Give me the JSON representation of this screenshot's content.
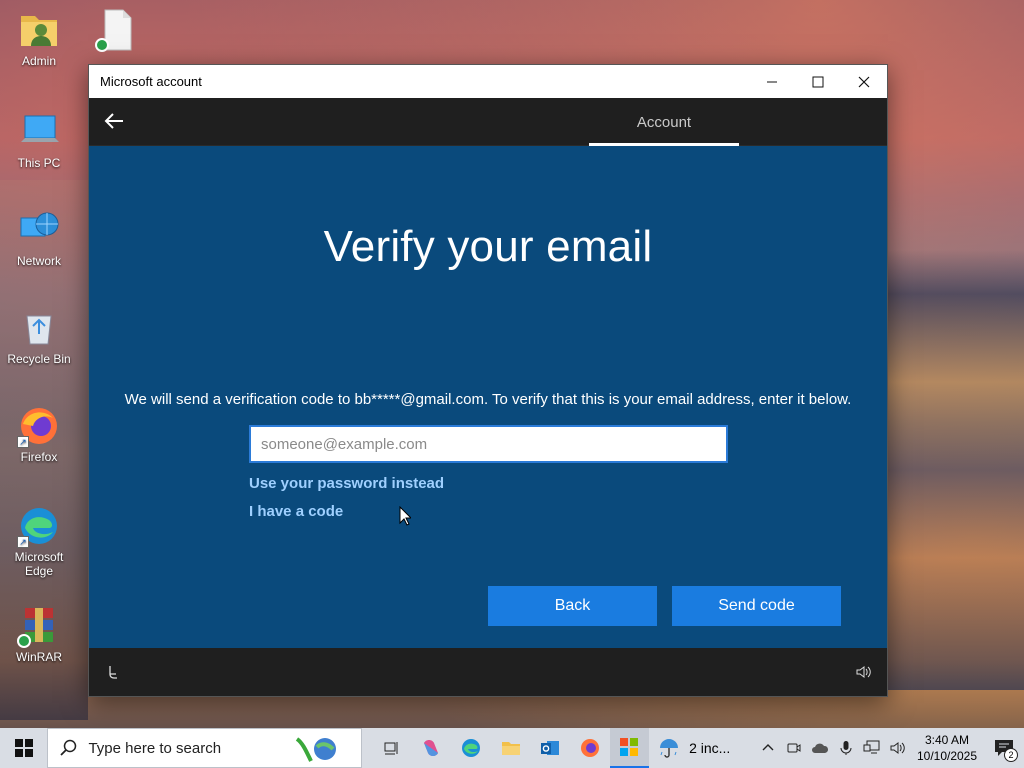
{
  "desktop": {
    "icons": [
      {
        "label": "Admin"
      },
      {
        "label": "This PC"
      },
      {
        "label": "Network"
      },
      {
        "label": "Recycle Bin"
      },
      {
        "label": "Firefox"
      },
      {
        "label": "Microsoft Edge"
      },
      {
        "label": "WinRAR"
      }
    ]
  },
  "window": {
    "title": "Microsoft account",
    "nav_tab": "Account",
    "heading": "Verify your email",
    "description": "We will send a verification code to bb*****@gmail.com. To verify that this is your email address, enter it below.",
    "email_placeholder": "someone@example.com",
    "email_value": "",
    "link_password": "Use your password instead",
    "link_code": "I have a code",
    "back_label": "Back",
    "send_label": "Send code"
  },
  "taskbar": {
    "search_placeholder": "Type here to search",
    "weather_text": "2 inc...",
    "time": "3:40 AM",
    "date": "10/10/2025",
    "notification_count": "2"
  },
  "colors": {
    "window_bg": "#0a4a7c",
    "button_bg": "#1a7ce0",
    "link": "#9fd0ff",
    "navbar": "#1f1f1f"
  }
}
